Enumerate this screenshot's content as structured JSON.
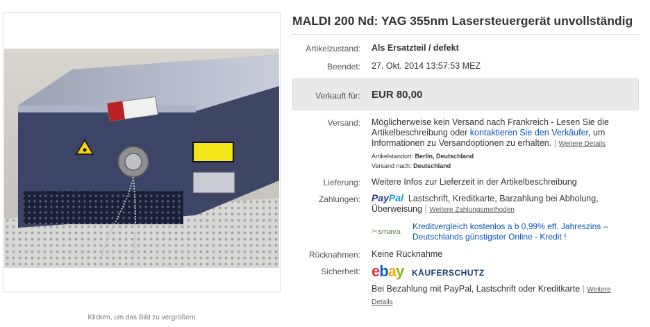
{
  "image": {
    "caption": "Klicken, um das Bild zu vergrößern",
    "label_danger": "DANGER",
    "label_warning": "invisible laser radiation emitted from this aperture",
    "label_plate": "MALDI 200 S/N 02-0250-0187A 355 nm"
  },
  "listing": {
    "title": "MALDI 200 Nd: YAG 355nm Lasersteuergerät unvollständig",
    "condition_label": "Artikelzustand:",
    "condition_value": "Als Ersatzteil / defekt",
    "ended_label": "Beendet:",
    "ended_value": "27. Okt. 2014  13:57:53 MEZ",
    "sold_label": "Verkauft für:",
    "sold_value": "EUR 80,00"
  },
  "shipping": {
    "label": "Versand:",
    "text_before": "Möglicherweise kein Versand nach Frankreich - Lesen Sie die Artikelbeschreibung oder ",
    "contact_link": "kontaktieren Sie den Verkäufer",
    "text_after": ", um Informationen zu Versandoptionen zu erhalten.",
    "details_link": "Weitere Details",
    "location_label": "Artikelstandort:",
    "location_value": "Berlin, Deutschland",
    "ships_to_label": "Versand nach:",
    "ships_to_value": "Deutschland"
  },
  "delivery": {
    "label": "Lieferung:",
    "value": "Weitere Infos zur Lieferzeit in der Artikelbeschreibung"
  },
  "payment": {
    "label": "Zahlungen:",
    "paypal_pay": "Pay",
    "paypal_pal": "Pal",
    "methods": "Lastschrift,  Kreditkarte,  Barzahlung bei Abholung, Überweisung",
    "more_link": "Weitere Zahlungsmethoden",
    "smava_logo": "smava",
    "smava_text": "Kreditvergleich kostenlos a b 0,99% eff. Jahreszins – Deutschlands günstigster Online - Kredit !"
  },
  "returns": {
    "label": "Rücknahmen:",
    "value": "Keine Rücknahme"
  },
  "security": {
    "label": "Sicherheit:",
    "ebay_e": "e",
    "ebay_b": "b",
    "ebay_a": "a",
    "ebay_y": "y",
    "protection": "KÄUFERSCHUTZ",
    "text": "Bei Bezahlung mit PayPal, Lastschrift oder Kreditkarte",
    "details_link": "Weitere Details"
  },
  "colors": {
    "link": "#0654ba",
    "sold_box": "#e9e9e9",
    "paypal_dark": "#253b80",
    "paypal_light": "#179bd7"
  }
}
